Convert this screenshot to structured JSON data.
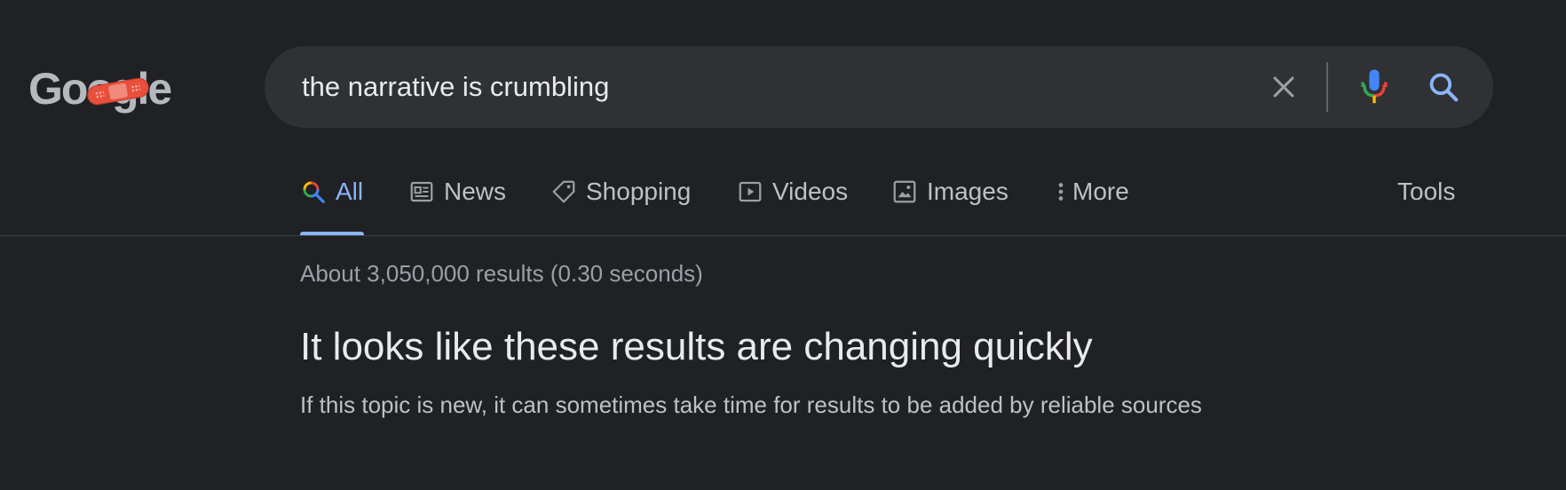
{
  "logo": {
    "text": "Google",
    "icon": "bandage-doodle-icon",
    "colors": {
      "text": "#b5b8bd",
      "bandage": "#e8503d"
    }
  },
  "search": {
    "query": "the narrative is crumbling",
    "clear_icon": "close-icon",
    "mic_icon": "microphone-icon",
    "search_icon": "search-icon"
  },
  "tabs": [
    {
      "label": "All",
      "icon": "search-icon",
      "active": true
    },
    {
      "label": "News",
      "icon": "newspaper-icon",
      "active": false
    },
    {
      "label": "Shopping",
      "icon": "tag-icon",
      "active": false
    },
    {
      "label": "Videos",
      "icon": "play-icon",
      "active": false
    },
    {
      "label": "Images",
      "icon": "image-icon",
      "active": false
    },
    {
      "label": "More",
      "icon": "more-vertical-icon",
      "active": false
    }
  ],
  "tools_label": "Tools",
  "results": {
    "stats": "About 3,050,000 results (0.30 seconds)",
    "notice_title": "It looks like these results are changing quickly",
    "notice_body": "If this topic is new, it can sometimes take time for results to be added by reliable sources"
  },
  "theme": {
    "background": "#202124",
    "searchbar_bg": "#303134",
    "accent": "#8ab4f8",
    "text_primary": "#e8eaed",
    "text_secondary": "#bdc1c6",
    "text_muted": "#9aa0a6"
  }
}
